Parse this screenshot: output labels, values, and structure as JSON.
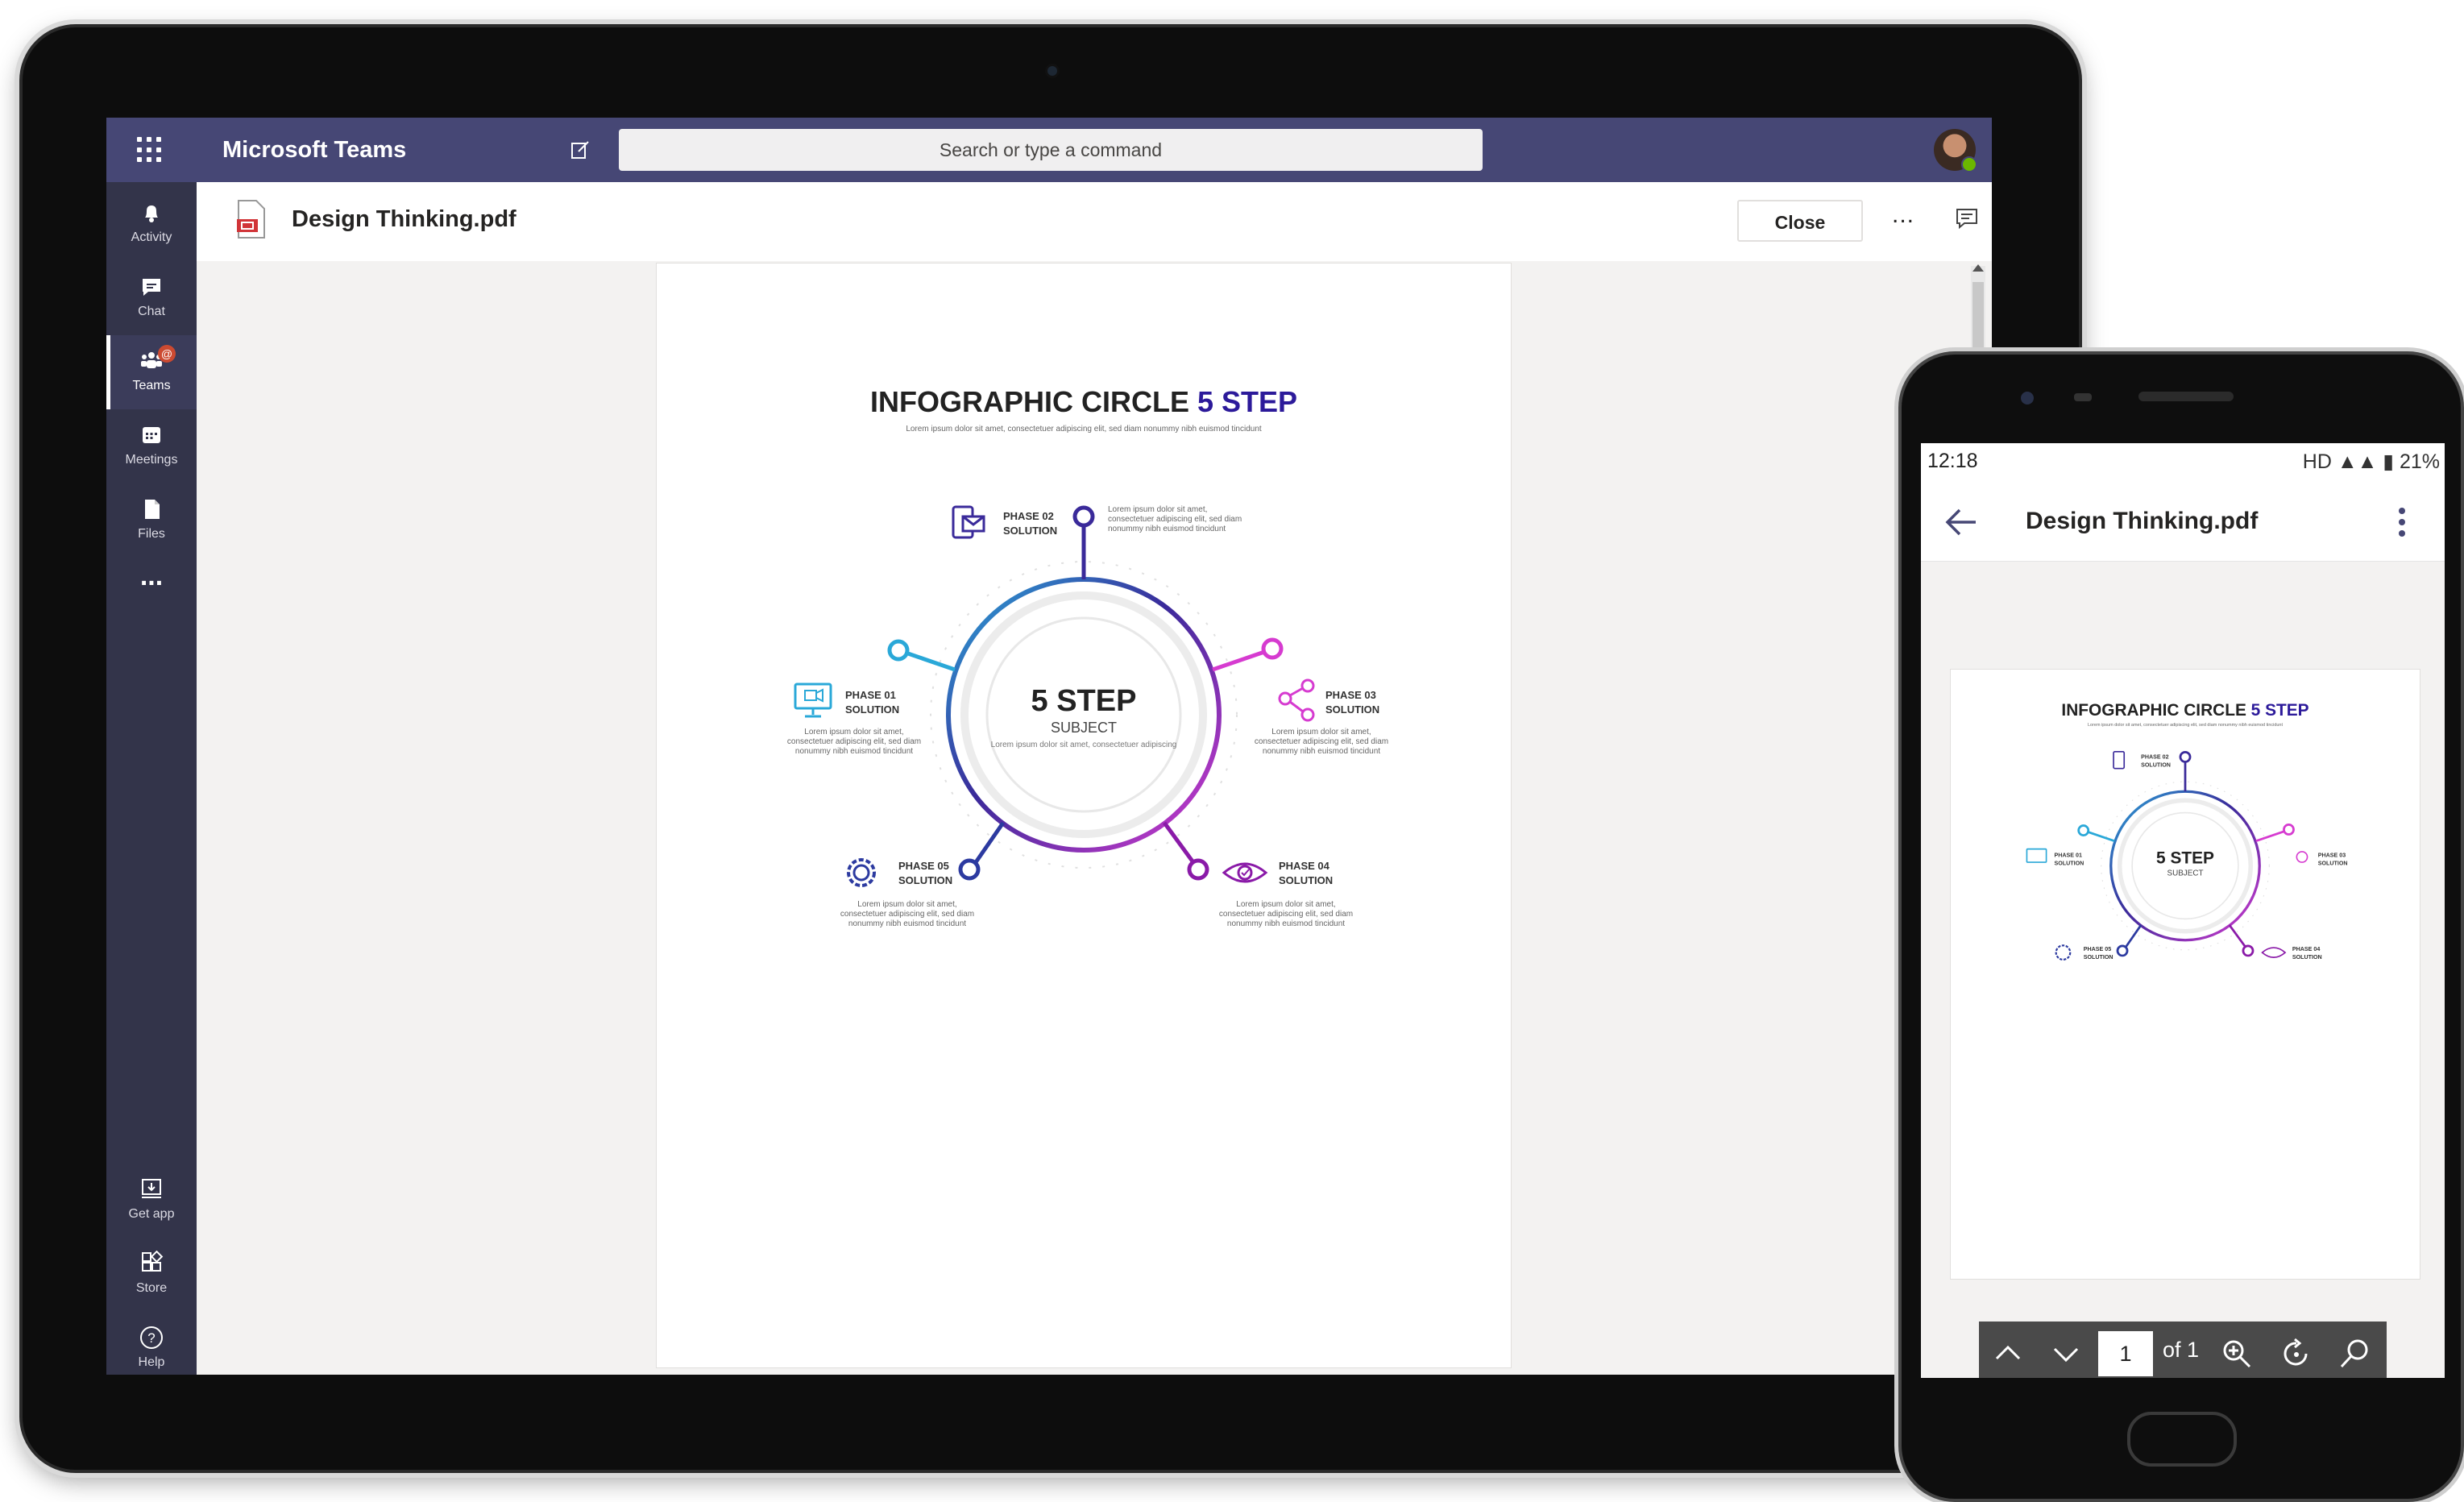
{
  "teams": {
    "app_title": "Microsoft Teams",
    "search_placeholder": "Search or type a command",
    "rail": [
      {
        "label": "Activity"
      },
      {
        "label": "Chat"
      },
      {
        "label": "Teams",
        "badge": "@"
      },
      {
        "label": "Meetings"
      },
      {
        "label": "Files"
      },
      {
        "label": "..."
      },
      {
        "label": "Get app"
      },
      {
        "label": "Store"
      },
      {
        "label": "Help"
      }
    ],
    "file_title": "Design Thinking.pdf",
    "close_label": "Close",
    "more_label": "...",
    "accent": "#464775"
  },
  "doc": {
    "title_main": "INFOGRAPHIC CIRCLE ",
    "title_accent": "5 STEP",
    "subtitle": "Lorem ipsum dolor sit amet, consectetuer adipiscing elit, sed diam nonummy nibh euismod tincidunt",
    "center_title": "5 STEP",
    "center_sub": "SUBJECT",
    "center_body": "Lorem ipsum dolor sit amet, consectetuer adipiscing",
    "phases": [
      {
        "phase": "PHASE 01",
        "label": "SOLUTION",
        "body": "Lorem ipsum dolor sit amet, consectetuer adipiscing elit, sed diam nonummy nibh euismod tincidunt",
        "color": "#2aa8d8"
      },
      {
        "phase": "PHASE 02",
        "label": "SOLUTION",
        "body": "Lorem ipsum dolor sit amet, consectetuer adipiscing elit, sed diam nonummy nibh euismod tincidunt",
        "color": "#3a2a9a"
      },
      {
        "phase": "PHASE 03",
        "label": "SOLUTION",
        "body": "Lorem ipsum dolor sit amet, consectetuer adipiscing elit, sed diam nonummy nibh euismod tincidunt",
        "color": "#d63bd0"
      },
      {
        "phase": "PHASE 04",
        "label": "SOLUTION",
        "body": "Lorem ipsum dolor sit amet, consectetuer adipiscing elit, sed diam nonummy nibh euismod tincidunt",
        "color": "#8a1aa8"
      },
      {
        "phase": "PHASE 05",
        "label": "SOLUTION",
        "body": "Lorem ipsum dolor sit amet, consectetuer adipiscing elit, sed diam nonummy nibh euismod tincidunt",
        "color": "#2c3aa0"
      }
    ]
  },
  "phone": {
    "time": "12:18",
    "status_right": "HD ▲▲ ▮ 21%",
    "title": "Design Thinking.pdf",
    "page_number": "1",
    "page_of": "of 1"
  }
}
